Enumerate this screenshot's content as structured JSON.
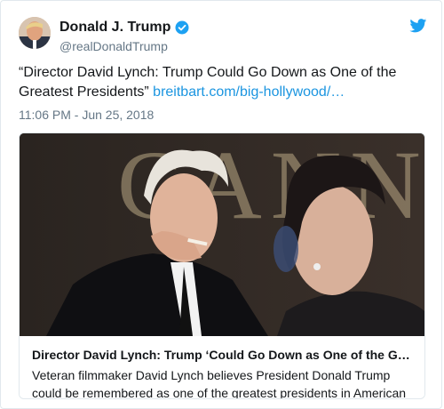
{
  "tweet": {
    "display_name": "Donald J. Trump",
    "handle": "@realDonaldTrump",
    "text": "“Director David Lynch: Trump Could Go Down as One of the Greatest Presidents” ",
    "link": "breitbart.com/big-hollywood/…",
    "timestamp": "11:06 PM - Jun 25, 2018"
  },
  "card": {
    "image_sign_text": "CANNES",
    "title": "Director David Lynch: Trump ‘Could Go Down as One of the Greatest Presidents’",
    "description": "Veteran filmmaker David Lynch believes President Donald Trump could be remembered as one of the greatest presidents in American history"
  },
  "icons": {
    "verified": "verified-badge-icon",
    "platform": "twitter-bird-icon"
  },
  "colors": {
    "link": "#1b95e0",
    "text": "#14171a",
    "secondary": "#657786",
    "brand": "#1da1f2"
  }
}
